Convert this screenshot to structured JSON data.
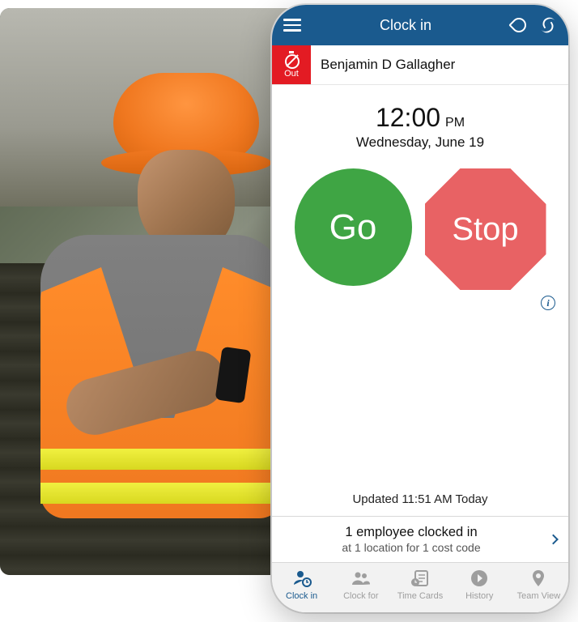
{
  "header": {
    "title": "Clock in"
  },
  "user": {
    "status_label": "Out",
    "name": "Benjamin D Gallagher"
  },
  "clock": {
    "time": "12:00",
    "ampm": "PM",
    "date": "Wednesday, June 19",
    "go_label": "Go",
    "stop_label": "Stop",
    "updated_text": "Updated 11:51 AM Today"
  },
  "summary": {
    "main": "1 employee clocked in",
    "sub": "at 1 location for 1 cost code"
  },
  "nav": {
    "clock_in": "Clock in",
    "clock_for": "Clock for",
    "time_cards": "Time Cards",
    "history": "History",
    "team_view": "Team View"
  }
}
